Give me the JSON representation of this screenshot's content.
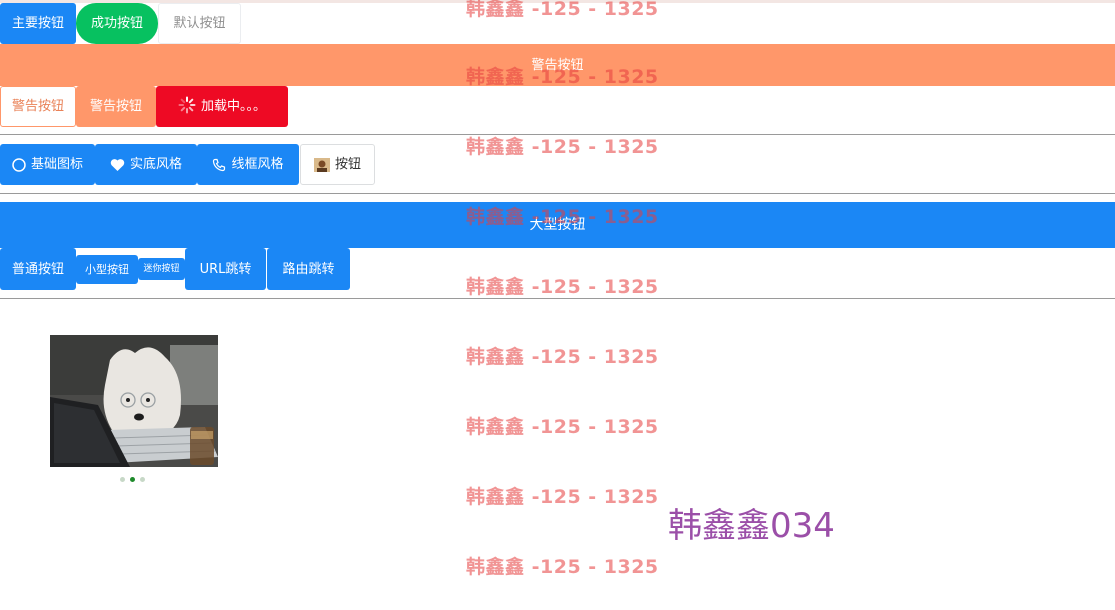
{
  "row1": {
    "primary": "主要按钮",
    "success": "成功按钮",
    "default": "默认按钮"
  },
  "row2": {
    "warning_block": "警告按钮"
  },
  "row3": {
    "warning_plain": "警告按钮",
    "warning": "警告按钮",
    "loading": "加载中。。。"
  },
  "row4": {
    "basic_icon": "基础图标",
    "solid_style": "实底风格",
    "outline_style": "线框风格",
    "image_button": "按钮"
  },
  "row5": {
    "large": "大型按钮"
  },
  "row6": {
    "normal": "普通按钮",
    "small": "小型按钮",
    "mini": "迷你按钮",
    "url_jump": "URL跳转",
    "route_jump": "路由跳转"
  },
  "swipe": {
    "count": 3,
    "active_index": 1
  },
  "watermark": "韩鑫鑫 -125 - 1325",
  "signature": "韩鑫鑫034",
  "colors": {
    "primary": "#1b87f5",
    "success": "#07c160",
    "warning": "#ff976a",
    "danger": "#ee0a24",
    "watermark": "#e63c3c",
    "signature": "#9b4fa8"
  },
  "icons": [
    "circle-icon",
    "heart-icon",
    "phone-icon",
    "avatar-image-icon",
    "loading-spinner-icon"
  ]
}
